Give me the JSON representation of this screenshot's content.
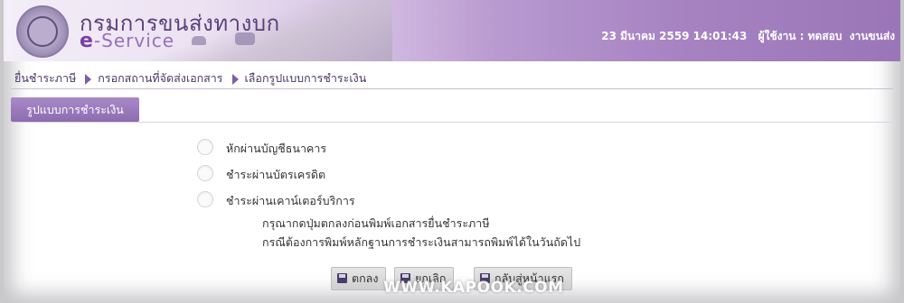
{
  "header": {
    "title_th": "กรมการขนส่งทางบก",
    "title_en_prefix": "e",
    "title_en_suffix": "-Service",
    "datetime": "23 มีนาคม 2559 14:01:43",
    "user_label": "ผู้ใช้งาน : ทดสอบ",
    "user_name": "งานขนส่ง"
  },
  "breadcrumb": [
    "ยื่นชำระภาษี",
    "กรอกสถานที่จัดส่งเอกสาร",
    "เลือกรูปแบบการชำระเงิน"
  ],
  "section": {
    "tab_label": "รูปแบบการชำระเงิน"
  },
  "payment_options": [
    {
      "label": "หักผ่านบัญชีธนาคาร",
      "selected": false
    },
    {
      "label": "ชำระผ่านบัตรเครดิต",
      "selected": false
    },
    {
      "label": "ชำระผ่านเคาน์เตอร์บริการ",
      "selected": false
    }
  ],
  "notes": [
    "กรุณากดปุ่มตกลงก่อนพิมพ์เอกสารยื่นชำระภาษี",
    "กรณีต้องการพิมพ์หลักฐานการชำระเงินสามารถพิมพ์ได้ในวันถัดไป"
  ],
  "buttons": {
    "ok": "ตกลง",
    "cancel": "ยกเลิก",
    "home": "กลับสู่หน้าแรก"
  },
  "watermark": "WWW.KAPOOK.COM",
  "colors": {
    "accent": "#8d6bb0",
    "header_dark": "#9a76b8",
    "text": "#333333"
  }
}
